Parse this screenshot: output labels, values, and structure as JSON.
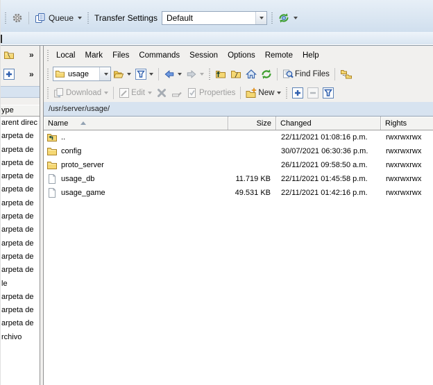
{
  "topbar": {
    "queue_label": "Queue",
    "transfer_settings_label": "Transfer Settings",
    "transfer_settings_value": "Default"
  },
  "left_panel": {
    "overflow_chevron": "»",
    "type_header_fragment": "ype",
    "row_fragments": [
      "arent direc",
      "arpeta de",
      "arpeta de",
      "arpeta de",
      "arpeta de",
      "arpeta de",
      "arpeta de",
      "arpeta de",
      "arpeta de",
      "arpeta de",
      "arpeta de",
      "arpeta de",
      "le",
      "arpeta de",
      "arpeta de",
      "arpeta de",
      "rchivo"
    ]
  },
  "menubar": {
    "items": [
      "Local",
      "Mark",
      "Files",
      "Commands",
      "Session",
      "Options",
      "Remote",
      "Help"
    ]
  },
  "addressbar": {
    "location_value": "usage",
    "find_files_label": "Find Files"
  },
  "buttonbar": {
    "download_label": "Download",
    "edit_label": "Edit",
    "properties_label": "Properties",
    "new_label": "New"
  },
  "pathbar": {
    "path": "/usr/server/usage/"
  },
  "file_table": {
    "columns": [
      "Name",
      "Size",
      "Changed",
      "Rights"
    ],
    "sorted_by": "Name",
    "sort_direction": "ascending",
    "rows": [
      {
        "icon": "folder-up",
        "name": "..",
        "size": "",
        "changed": "22/11/2021 01:08:16 p.m.",
        "rights": "rwxrwxrwx"
      },
      {
        "icon": "folder",
        "name": "config",
        "size": "",
        "changed": "30/07/2021 06:30:36 p.m.",
        "rights": "rwxrwxrwx"
      },
      {
        "icon": "folder",
        "name": "proto_server",
        "size": "",
        "changed": "26/11/2021 09:58:50 a.m.",
        "rights": "rwxrwxrwx"
      },
      {
        "icon": "file",
        "name": "usage_db",
        "size": "11.719 KB",
        "changed": "22/11/2021 01:45:58 p.m.",
        "rights": "rwxrwxrwx"
      },
      {
        "icon": "file",
        "name": "usage_game",
        "size": "49.531 KB",
        "changed": "22/11/2021 01:42:16 p.m.",
        "rights": "rwxrwxrwx"
      }
    ]
  },
  "colors": {
    "topbar_bg": "#d9e5f2",
    "toolbar_bg": "#f1f0ee",
    "pathbar_bg": "#d7e3f0",
    "accent_blue": "#2f5fae",
    "folder_yellow": "#f5d874",
    "disabled_text": "#9e9e9e",
    "refresh_green": "#3d9e2d"
  }
}
